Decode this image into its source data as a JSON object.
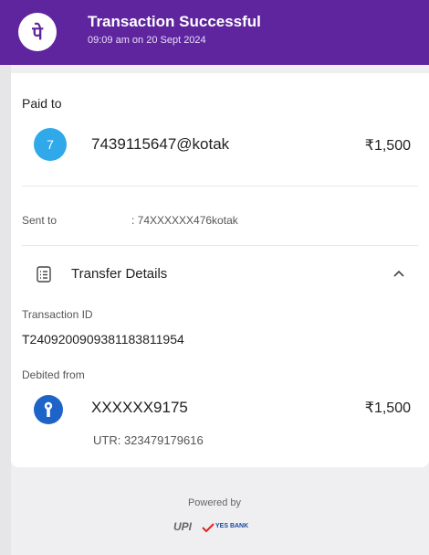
{
  "header": {
    "logo_glyph": "पे",
    "title": "Transaction Successful",
    "subtitle": "09:09 am on 20 Sept 2024",
    "color": "#5f259f"
  },
  "paid_to": {
    "label": "Paid to",
    "avatar_initial": "7",
    "avatar_color": "#2fa9ea",
    "vpa": "7439115647@kotak",
    "amount": "₹1,500"
  },
  "sent_to": {
    "label": "Sent to",
    "value": ": 74XXXXXX476kotak"
  },
  "transfer_details": {
    "title": "Transfer Details",
    "icon": "document-list-icon",
    "toggle_icon": "chevron-up-icon",
    "transaction_id_label": "Transaction ID",
    "transaction_id": "T2409200909381183811954",
    "debited_from_label": "Debited from",
    "account": "XXXXXX9175",
    "amount": "₹1,500",
    "utr": "UTR: 323479179616",
    "bank_color": "#1e64c8"
  },
  "footer": {
    "powered_by": "Powered by",
    "upi": "UPI",
    "bank": "YES BANK"
  }
}
